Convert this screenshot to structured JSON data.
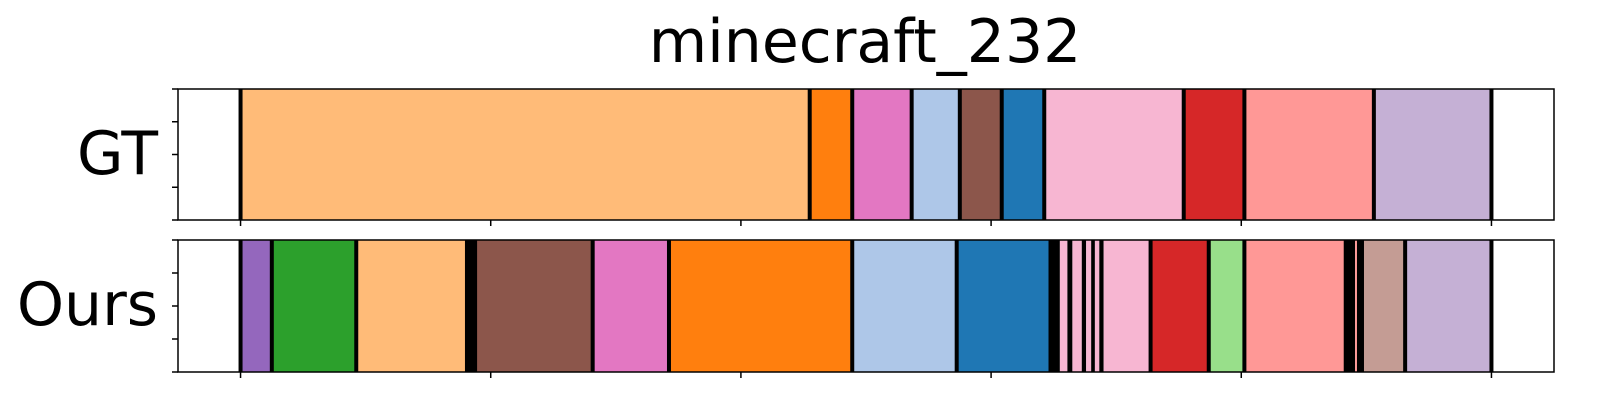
{
  "chart_data": {
    "type": "segmentation-timeline",
    "title": "minecraft_232",
    "rows": [
      {
        "label": "GT",
        "segments": [
          {
            "start": 0,
            "end": 1,
            "color": "#ffffff"
          },
          {
            "start": 1,
            "end": 10.1,
            "color": "#ffbb78"
          },
          {
            "start": 10.1,
            "end": 10.78,
            "color": "#ff7f0e"
          },
          {
            "start": 10.78,
            "end": 11.73,
            "color": "#e377c2"
          },
          {
            "start": 11.73,
            "end": 12.5,
            "color": "#aec7e8"
          },
          {
            "start": 12.5,
            "end": 13.17,
            "color": "#8c564b"
          },
          {
            "start": 13.17,
            "end": 13.85,
            "color": "#1f77b4"
          },
          {
            "start": 13.85,
            "end": 16.08,
            "color": "#f7b6d2"
          },
          {
            "start": 16.08,
            "end": 17.05,
            "color": "#d62728"
          },
          {
            "start": 17.05,
            "end": 19.12,
            "color": "#ff9896"
          },
          {
            "start": 19.12,
            "end": 21.0,
            "color": "#c5b0d5"
          },
          {
            "start": 21.0,
            "end": 22,
            "color": "#ffffff"
          }
        ],
        "boundaries": [
          1,
          10.1,
          10.78,
          11.73,
          12.5,
          13.17,
          13.85,
          16.08,
          17.05,
          19.12,
          21.0
        ]
      },
      {
        "label": "Ours",
        "segments": [
          {
            "start": 0,
            "end": 1,
            "color": "#ffffff"
          },
          {
            "start": 1,
            "end": 1.5,
            "color": "#9467bd"
          },
          {
            "start": 1.5,
            "end": 2.85,
            "color": "#2ca02c"
          },
          {
            "start": 2.85,
            "end": 4.62,
            "color": "#ffbb78"
          },
          {
            "start": 4.62,
            "end": 4.75,
            "color": "#000000"
          },
          {
            "start": 4.75,
            "end": 6.63,
            "color": "#8c564b"
          },
          {
            "start": 6.63,
            "end": 7.85,
            "color": "#e377c2"
          },
          {
            "start": 7.85,
            "end": 10.78,
            "color": "#ff7f0e"
          },
          {
            "start": 10.78,
            "end": 12.45,
            "color": "#aec7e8"
          },
          {
            "start": 12.45,
            "end": 13.95,
            "color": "#1f77b4"
          },
          {
            "start": 13.95,
            "end": 14.1,
            "color": "#000000"
          },
          {
            "start": 14.1,
            "end": 14.22,
            "color": "#f7b6d2"
          },
          {
            "start": 14.22,
            "end": 14.3,
            "color": "#000000"
          },
          {
            "start": 14.3,
            "end": 14.45,
            "color": "#f7b6d2"
          },
          {
            "start": 14.45,
            "end": 14.52,
            "color": "#000000"
          },
          {
            "start": 14.52,
            "end": 14.6,
            "color": "#f7b6d2"
          },
          {
            "start": 14.6,
            "end": 14.66,
            "color": "#000000"
          },
          {
            "start": 14.66,
            "end": 14.73,
            "color": "#f7b6d2"
          },
          {
            "start": 14.73,
            "end": 14.8,
            "color": "#000000"
          },
          {
            "start": 14.8,
            "end": 15.55,
            "color": "#f7b6d2"
          },
          {
            "start": 15.55,
            "end": 16.48,
            "color": "#d62728"
          },
          {
            "start": 16.48,
            "end": 17.05,
            "color": "#98df8a"
          },
          {
            "start": 17.05,
            "end": 18.67,
            "color": "#ff9896"
          },
          {
            "start": 18.67,
            "end": 18.82,
            "color": "#000000"
          },
          {
            "start": 18.82,
            "end": 18.85,
            "color": "#ff9896"
          },
          {
            "start": 18.85,
            "end": 18.93,
            "color": "#000000"
          },
          {
            "start": 18.93,
            "end": 19.62,
            "color": "#c49c94"
          },
          {
            "start": 19.62,
            "end": 21.0,
            "color": "#c5b0d5"
          },
          {
            "start": 21.0,
            "end": 22,
            "color": "#ffffff"
          }
        ],
        "boundaries": [
          1,
          1.5,
          2.85,
          4.62,
          4.75,
          6.63,
          7.85,
          10.78,
          12.45,
          13.95,
          15.55,
          16.48,
          17.05,
          18.67,
          18.93,
          19.62,
          21.0
        ]
      }
    ],
    "xlim": [
      0,
      22
    ],
    "x_ticks": [
      1,
      5,
      9,
      13,
      17,
      21
    ],
    "y_ticks_per_row": 5,
    "grid": false,
    "legend": "none",
    "boundary_color": "#000000"
  }
}
